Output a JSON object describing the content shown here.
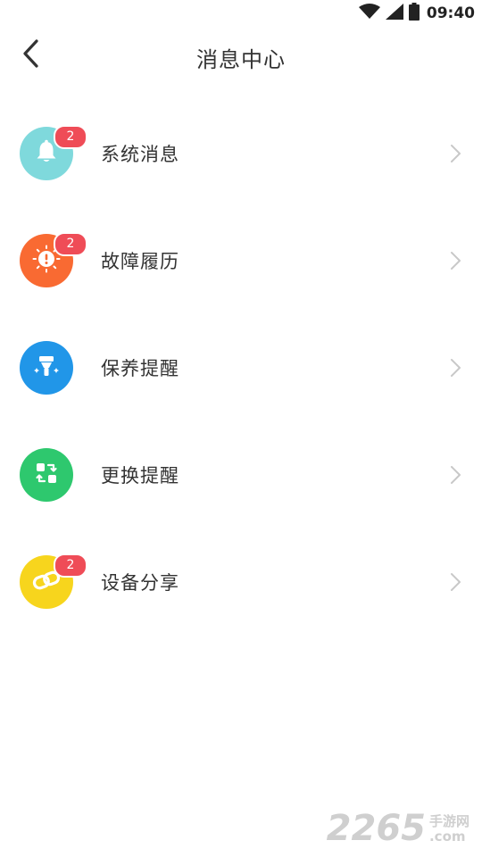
{
  "status_bar": {
    "time": "09:40"
  },
  "header": {
    "title": "消息中心",
    "back_icon": "chevron-left-icon"
  },
  "items": [
    {
      "label": "系统消息",
      "badge": "2",
      "icon": "bell-icon",
      "color": "#7fd9dc"
    },
    {
      "label": "故障履历",
      "badge": "2",
      "icon": "alert-icon",
      "color": "#f96a32"
    },
    {
      "label": "保养提醒",
      "badge": "",
      "icon": "maintenance-icon",
      "color": "#2196e8"
    },
    {
      "label": "更换提醒",
      "badge": "",
      "icon": "swap-icon",
      "color": "#2ec86e"
    },
    {
      "label": "设备分享",
      "badge": "2",
      "icon": "link-icon",
      "color": "#f7d51d"
    }
  ],
  "watermark": {
    "number": "2265",
    "cn": "手游网",
    "domain": ".com"
  }
}
